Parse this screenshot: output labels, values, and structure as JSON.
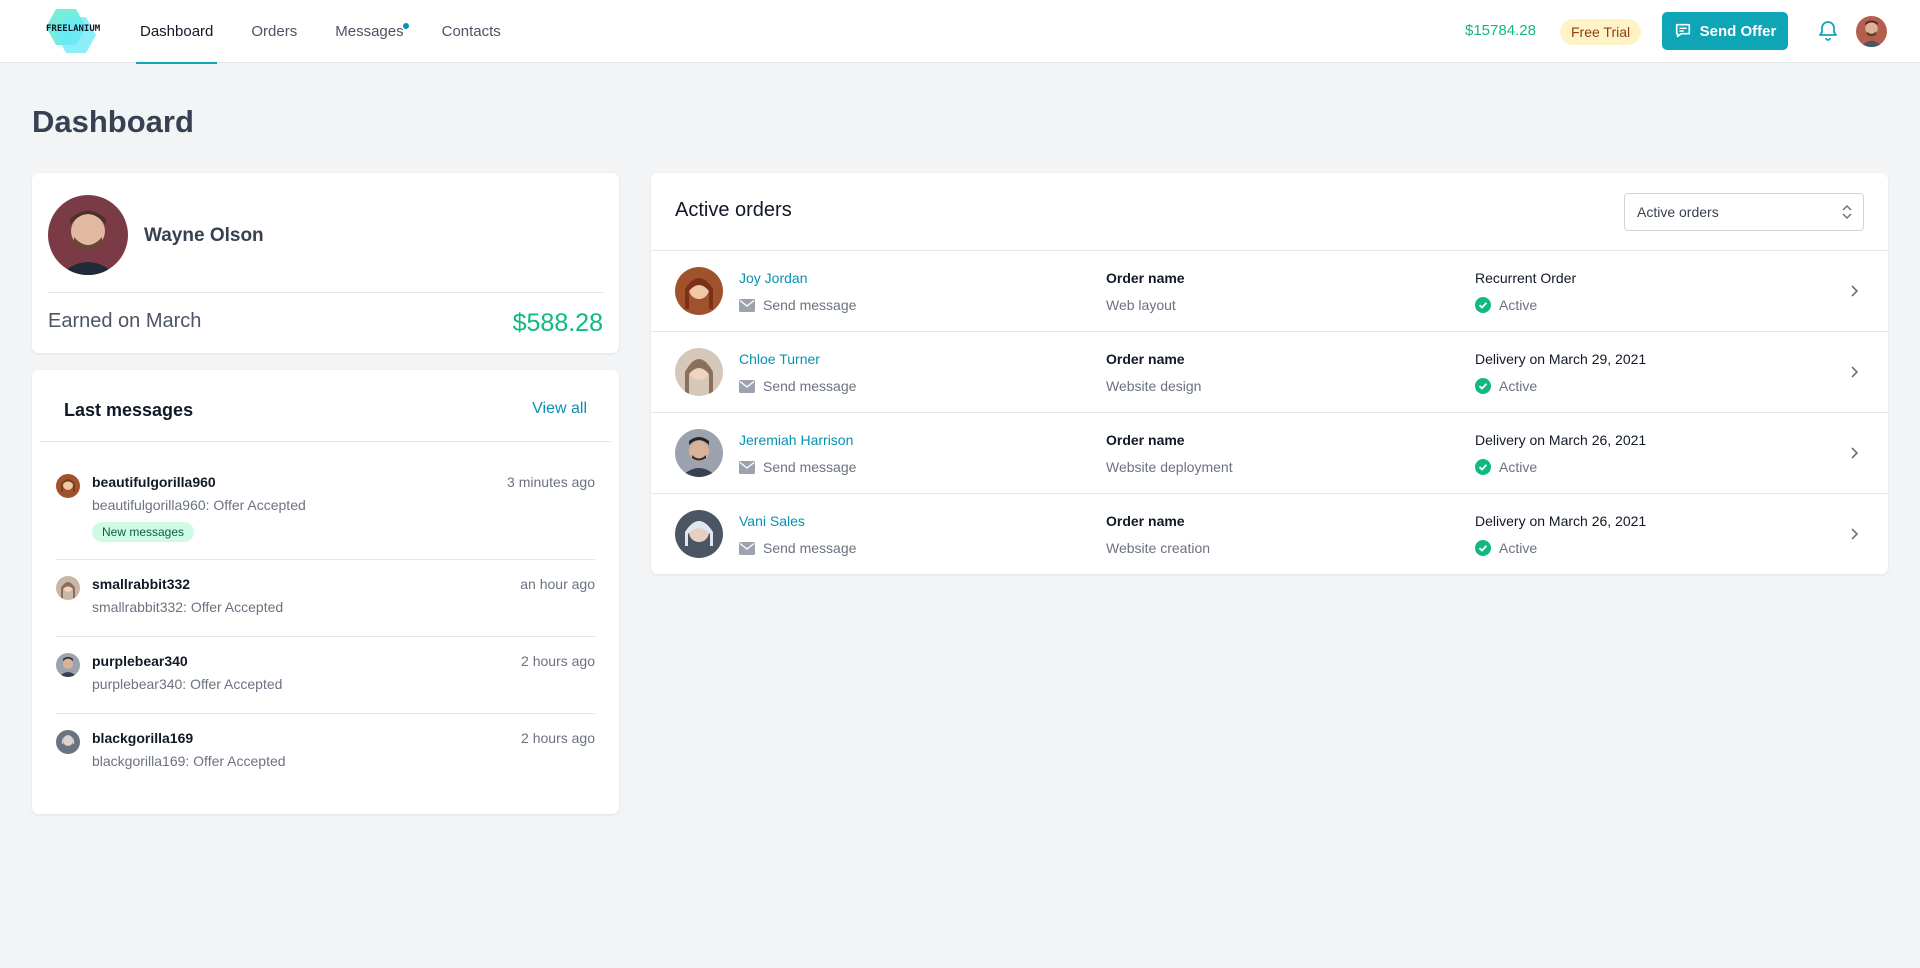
{
  "header": {
    "logo_text": "FREELANIUM",
    "nav": [
      {
        "label": "Dashboard",
        "active": true
      },
      {
        "label": "Orders",
        "active": false
      },
      {
        "label": "Messages",
        "active": false,
        "has_dot": true
      },
      {
        "label": "Contacts",
        "active": false
      }
    ],
    "balance": "$15784.28",
    "trial_badge": "Free Trial",
    "send_offer_label": "Send Offer",
    "icons": {
      "send_offer": "chat-icon",
      "bell": "bell-icon"
    }
  },
  "page": {
    "title": "Dashboard"
  },
  "profile": {
    "name": "Wayne Olson",
    "earned_label": "Earned on March",
    "earned_value": "$588.28"
  },
  "messages": {
    "title": "Last messages",
    "view_all": "View all",
    "items": [
      {
        "user": "beautifulgorilla960",
        "time": "3 minutes ago",
        "text": "beautifulgorilla960: Offer Accepted",
        "badge": "New messages"
      },
      {
        "user": "smallrabbit332",
        "time": "an hour ago",
        "text": "smallrabbit332: Offer Accepted"
      },
      {
        "user": "purplebear340",
        "time": "2 hours ago",
        "text": "purplebear340: Offer Accepted"
      },
      {
        "user": "blackgorilla169",
        "time": "2 hours ago",
        "text": "blackgorilla169: Offer Accepted"
      }
    ]
  },
  "orders": {
    "title": "Active orders",
    "filter_value": "Active orders",
    "rows": [
      {
        "client": "Joy Jordan",
        "send_message": "Send message",
        "order_name_label": "Order name",
        "order_name": "Web layout",
        "type": "Recurrent Order",
        "status": "Active"
      },
      {
        "client": "Chloe Turner",
        "send_message": "Send message",
        "order_name_label": "Order name",
        "order_name": "Website design",
        "type": "Delivery on March 29, 2021",
        "status": "Active"
      },
      {
        "client": "Jeremiah Harrison",
        "send_message": "Send message",
        "order_name_label": "Order name",
        "order_name": "Website deployment",
        "type": "Delivery on March 26, 2021",
        "status": "Active"
      },
      {
        "client": "Vani Sales",
        "send_message": "Send message",
        "order_name_label": "Order name",
        "order_name": "Website creation",
        "type": "Delivery on March 26, 2021",
        "status": "Active"
      }
    ]
  },
  "colors": {
    "accent": "#0ea5b7",
    "link": "#0891b2",
    "success": "#10b981",
    "trial_bg": "#fef3c7"
  }
}
